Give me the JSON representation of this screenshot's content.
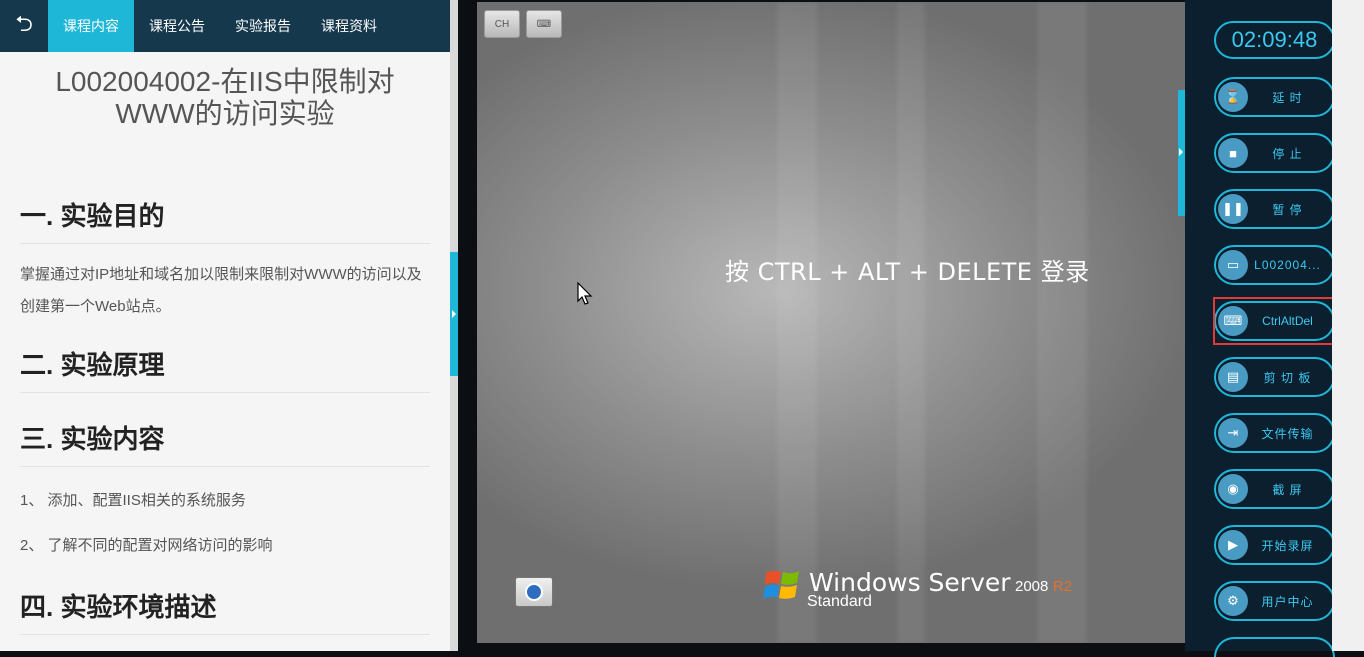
{
  "nav": {
    "back_icon": "back-arrow-icon",
    "tabs": [
      {
        "label": "课程内容",
        "active": true
      },
      {
        "label": "课程公告",
        "active": false
      },
      {
        "label": "实验报告",
        "active": false
      },
      {
        "label": "课程资料",
        "active": false
      }
    ]
  },
  "doc": {
    "title_line1": "L002004002-在IIS中限制对",
    "title_line2": "WWW的访问实验",
    "sections": [
      {
        "heading": "一. 实验目的",
        "text": "掌握通过对IP地址和域名加以限制来限制对WWW的访问以及创建第一个Web站点。"
      },
      {
        "heading": "二. 实验原理"
      },
      {
        "heading": "三. 实验内容",
        "items": [
          "1、 添加、配置IIS相关的系统服务",
          "2、 了解不同的配置对网络访问的影响"
        ]
      },
      {
        "heading": "四. 实验环境描述"
      }
    ]
  },
  "remote": {
    "ch_label": "CH",
    "login_prompt": "按 CTRL + ALT + DELETE 登录",
    "brand": {
      "name": "Windows Server",
      "version": "2008",
      "r2": "R2",
      "edition": "Standard"
    }
  },
  "sidebar": {
    "timer": "02:09:48",
    "buttons": [
      {
        "label": "延  时",
        "icon": "hourglass-icon",
        "glyph": "⌛"
      },
      {
        "label": "停  止",
        "icon": "stop-icon",
        "glyph": "■"
      },
      {
        "label": "暂  停",
        "icon": "pause-icon",
        "glyph": "❚❚"
      },
      {
        "label": "L002004...",
        "icon": "monitor-icon",
        "glyph": "▭"
      },
      {
        "label": "CtrlAltDel",
        "icon": "keyboard-icon",
        "glyph": "⌨"
      },
      {
        "label": "剪 切 板",
        "icon": "clipboard-icon",
        "glyph": "▤"
      },
      {
        "label": "文件传输",
        "icon": "file-transfer-icon",
        "glyph": "⇥"
      },
      {
        "label": "截  屏",
        "icon": "camera-icon",
        "glyph": "◉"
      },
      {
        "label": "开始录屏",
        "icon": "record-icon",
        "glyph": "▶"
      },
      {
        "label": "用户中心",
        "icon": "gear-icon",
        "glyph": "⚙"
      }
    ]
  },
  "colors": {
    "accent": "#1fb7d8",
    "nav_bg": "#15384c",
    "highlight": "#e53935"
  }
}
